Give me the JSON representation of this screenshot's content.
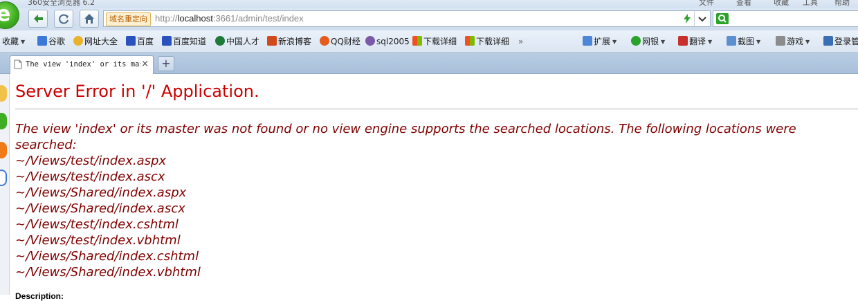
{
  "browser": {
    "window_title": "360安全浏览器 6.2",
    "menu": [
      "文件",
      "查看",
      "收藏",
      "工具",
      "帮助"
    ],
    "address_bar": {
      "redirect_badge": "域名重定向",
      "url_scheme": "http://",
      "url_host": "localhost",
      "url_rest": ":3661/admin/test/index"
    },
    "bookmarks": {
      "favorites_label": "收藏",
      "items": [
        "谷歌",
        "网址大全",
        "百度",
        "百度知道",
        "中国人才",
        "新浪博客",
        "QQ财经",
        "sql2005",
        "下载详细",
        "下载详细"
      ],
      "more": "»",
      "tools": [
        "扩展",
        "网银",
        "翻译",
        "截图",
        "游戏",
        "登录管"
      ]
    },
    "tab": {
      "title": "The view 'index' or its master was not found",
      "close": "×",
      "new_tab": "+"
    }
  },
  "page": {
    "error_title": "Server Error in '/' Application.",
    "error_message": "The view 'index' or its master was not found or no view engine supports the searched locations. The following locations were searched:",
    "locations": [
      "~/Views/test/index.aspx",
      "~/Views/test/index.ascx",
      "~/Views/Shared/index.aspx",
      "~/Views/Shared/index.ascx",
      "~/Views/test/index.cshtml",
      "~/Views/test/index.vbhtml",
      "~/Views/Shared/index.cshtml",
      "~/Views/Shared/index.vbhtml"
    ],
    "description_label": "Description:"
  },
  "colors": {
    "error_title": "#cc0000",
    "error_message": "#800000",
    "tab_bar": "#b9cde3"
  }
}
